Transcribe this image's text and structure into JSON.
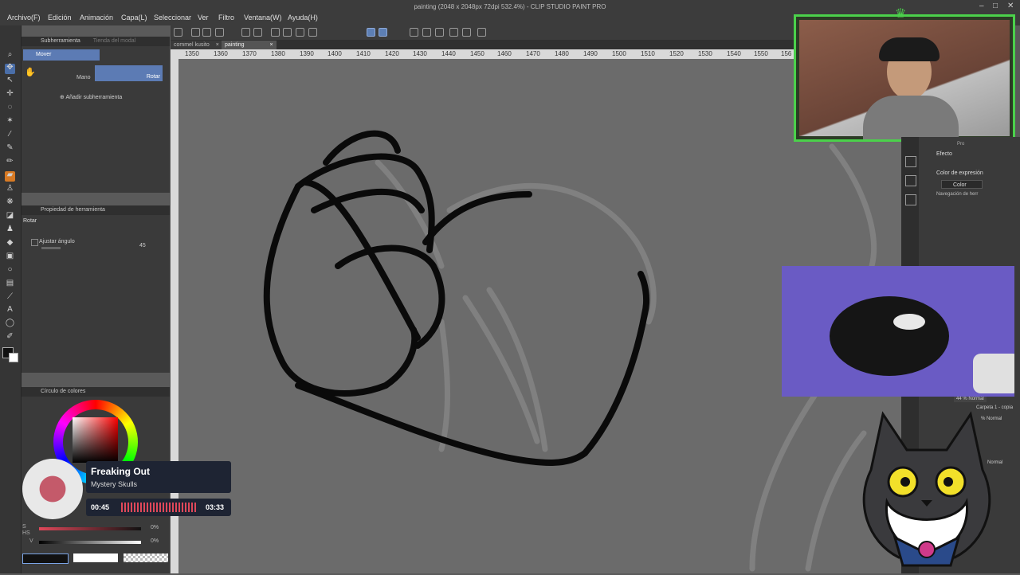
{
  "window": {
    "title": "painting (2048 x 2048px 72dpi 532.4%) - CLIP STUDIO PAINT PRO",
    "minimize": "–",
    "maximize": "□",
    "close": "✕"
  },
  "menu": [
    "Archivo(F)",
    "Edición",
    "Animación",
    "Capa(L)",
    "Seleccionar",
    "Ver",
    "Filtro",
    "Ventana(W)",
    "Ayuda(H)"
  ],
  "tabs": [
    {
      "label": "commel kusito",
      "close": "×"
    },
    {
      "label": "painting",
      "close": "×"
    }
  ],
  "ruler": [
    "1350",
    "1360",
    "1370",
    "1380",
    "1390",
    "1400",
    "1410",
    "1420",
    "1430",
    "1440",
    "1450",
    "1460",
    "1470",
    "1480",
    "1490",
    "1500",
    "1510",
    "1520",
    "1530",
    "1540",
    "1550",
    "156"
  ],
  "subtool": {
    "panel_tab": "Subherramienta",
    "panel_tab2": "Tienda del modal",
    "group": "Mover",
    "items": [
      "Mano",
      "Rotar"
    ],
    "add": "Añadir subherramienta"
  },
  "tool_property": {
    "title": "Propiedad de herramienta",
    "tool_name": "Rotar",
    "option_label": "Ajustar ángulo",
    "option_value": "45"
  },
  "color_wheel": {
    "title": "Círculo de colores",
    "sliders": [
      "S",
      "V"
    ],
    "s_value": "0%",
    "v_value": "0%",
    "hs_label": "HS"
  },
  "right_panel": {
    "tab": "Pro",
    "effect_label": "Efecto",
    "expression_label": "Color de expresión",
    "expression_value": "Color",
    "nav_label": "Navegación de herr",
    "layers": [
      {
        "opacity": "44 %",
        "blend": "Normal",
        "name": "Carpeta 1 - copia"
      },
      {
        "opacity": "%",
        "blend": "Normal",
        "name": ""
      }
    ],
    "layer_extra": "Normal"
  },
  "music": {
    "title": "Freaking Out",
    "artist": "Mystery Skulls",
    "current_time": "00:45",
    "total_time": "03:33"
  },
  "colors": {
    "accent": "#4a6ea8",
    "menubar": "#3c3c3c",
    "canvas": "#6b6b6b",
    "webcam_frame": "#4bd14b",
    "bed": "#6a5bc4",
    "music_card": "#1e2433",
    "waveform": "#e0485a"
  }
}
